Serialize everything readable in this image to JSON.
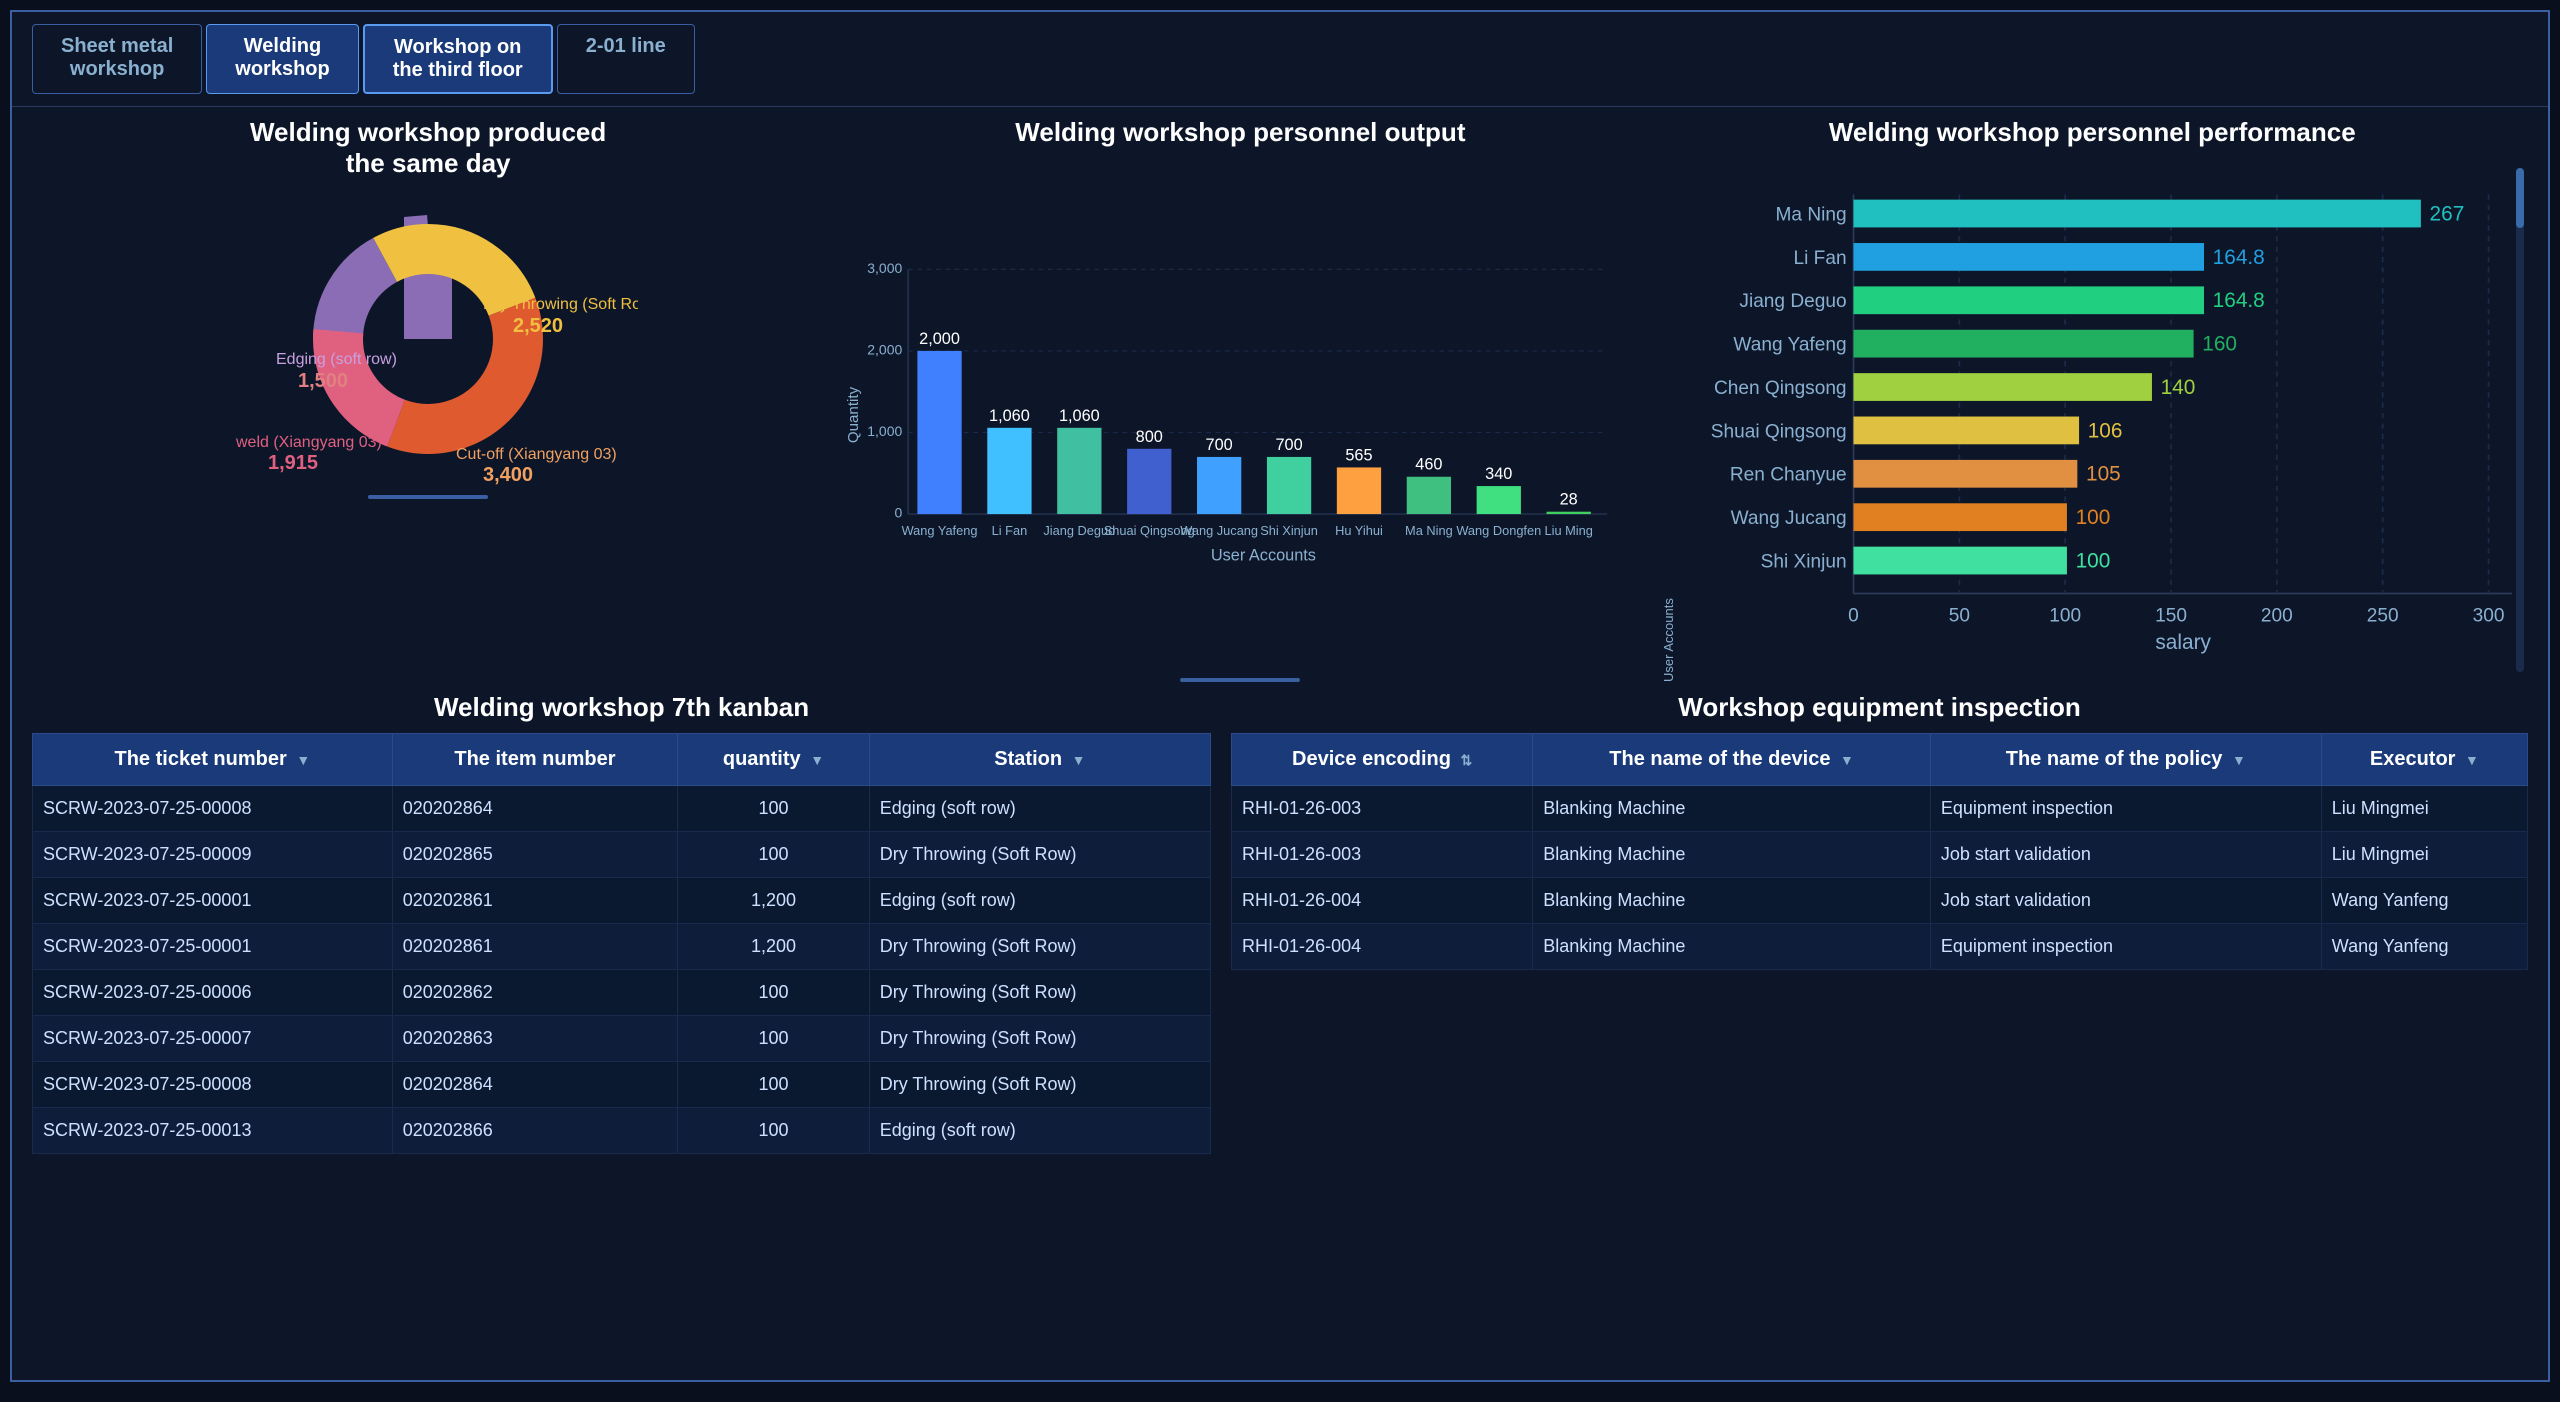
{
  "tabs": [
    {
      "label": "Sheet metal\nworkshop",
      "active": false
    },
    {
      "label": "Welding\nworkshop",
      "active": true
    },
    {
      "label": "Workshop on\nthe third floor",
      "active": true
    },
    {
      "label": "2-01 line",
      "active": false
    }
  ],
  "donut": {
    "title": "Welding workshop produced the same day",
    "segments": [
      {
        "label": "Edging (soft row)",
        "value": 1500,
        "color": "#8b6db5",
        "percentage": 17
      },
      {
        "label": "Dry Throwing (Soft Row)",
        "value": 2520,
        "color": "#f0c040",
        "percentage": 29
      },
      {
        "label": "Cut-off (Xiangyang 03)",
        "value": 3400,
        "color": "#e05a30",
        "percentage": 39
      },
      {
        "label": "weld (Xiangyang 03)",
        "value": 1915,
        "color": "#e06080",
        "percentage": 22
      }
    ]
  },
  "bar_chart": {
    "title": "Welding workshop personnel output",
    "y_label": "Quantity",
    "x_label": "User Accounts",
    "y_max": 3000,
    "y_ticks": [
      0,
      1000,
      2000,
      3000
    ],
    "bars": [
      {
        "name": "Wang Yafeng",
        "value": 2000,
        "color": "#4080ff"
      },
      {
        "name": "Li Fan",
        "value": 1060,
        "color": "#40c0ff"
      },
      {
        "name": "Jiang Deguo",
        "value": 1060,
        "color": "#40c0a0"
      },
      {
        "name": "Shuai Qingsong",
        "value": 800,
        "color": "#4060d0"
      },
      {
        "name": "Wang Jucang",
        "value": 700,
        "color": "#40a0ff"
      },
      {
        "name": "Shi Xinjun",
        "value": 700,
        "color": "#40d0a0"
      },
      {
        "name": "Hu Yihui",
        "value": 565,
        "color": "#ffa040"
      },
      {
        "name": "Ma Ning",
        "value": 460,
        "color": "#40c080"
      },
      {
        "name": "Wang Dongfen",
        "value": 340,
        "color": "#40e080"
      },
      {
        "name": "Liu Ming",
        "value": 28,
        "color": "#40d060"
      }
    ]
  },
  "h_bar_chart": {
    "title": "Welding workshop personnel performance",
    "x_label": "salary",
    "x_ticks": [
      0,
      50,
      100,
      150,
      200,
      250,
      300
    ],
    "bars": [
      {
        "name": "Ma Ning",
        "value": 267,
        "color": "#20c0c0"
      },
      {
        "name": "Li Fan",
        "value": 164.8,
        "color": "#20a0e0"
      },
      {
        "name": "Jiang Deguo",
        "value": 164.8,
        "color": "#20d080"
      },
      {
        "name": "Wang Yafeng",
        "value": 160,
        "color": "#20b060"
      },
      {
        "name": "Chen Qingsong",
        "value": 140,
        "color": "#a0d040"
      },
      {
        "name": "Shuai Qingsong",
        "value": 106,
        "color": "#e0c040"
      },
      {
        "name": "Ren Chanyue",
        "value": 105,
        "color": "#e09040"
      },
      {
        "name": "Wang Jucang",
        "value": 100,
        "color": "#e08020"
      },
      {
        "name": "Shi Xinjun",
        "value": 100,
        "color": "#40e0a0"
      }
    ],
    "x_max": 310
  },
  "kanban_table": {
    "title": "Welding workshop 7th kanban",
    "columns": [
      "The ticket number",
      "The item number",
      "quantity",
      "Station"
    ],
    "rows": [
      {
        "ticket": "SCRW-2023-07-25-00008",
        "item": "020202864",
        "quantity": "100",
        "station": "Edging (soft row)"
      },
      {
        "ticket": "SCRW-2023-07-25-00009",
        "item": "020202865",
        "quantity": "100",
        "station": "Dry Throwing (Soft Row)"
      },
      {
        "ticket": "SCRW-2023-07-25-00001",
        "item": "020202861",
        "quantity": "1,200",
        "station": "Edging (soft row)"
      },
      {
        "ticket": "SCRW-2023-07-25-00001",
        "item": "020202861",
        "quantity": "1,200",
        "station": "Dry Throwing (Soft Row)"
      },
      {
        "ticket": "SCRW-2023-07-25-00006",
        "item": "020202862",
        "quantity": "100",
        "station": "Dry Throwing (Soft Row)"
      },
      {
        "ticket": "SCRW-2023-07-25-00007",
        "item": "020202863",
        "quantity": "100",
        "station": "Dry Throwing (Soft Row)"
      },
      {
        "ticket": "SCRW-2023-07-25-00008",
        "item": "020202864",
        "quantity": "100",
        "station": "Dry Throwing (Soft Row)"
      },
      {
        "ticket": "SCRW-2023-07-25-00013",
        "item": "020202866",
        "quantity": "100",
        "station": "Edging (soft row)"
      }
    ]
  },
  "inspection_table": {
    "title": "Workshop equipment inspection",
    "columns": [
      "Device encoding",
      "The name of the device",
      "The name of the policy",
      "Executor"
    ],
    "rows": [
      {
        "device_enc": "RHI-01-26-003",
        "device_name": "Blanking Machine",
        "policy": "Equipment inspection",
        "executor": "Liu Mingmei"
      },
      {
        "device_enc": "RHI-01-26-003",
        "device_name": "Blanking Machine",
        "policy": "Job start validation",
        "executor": "Liu Mingmei"
      },
      {
        "device_enc": "RHI-01-26-004",
        "device_name": "Blanking Machine",
        "policy": "Job start validation",
        "executor": "Wang Yanfeng"
      },
      {
        "device_enc": "RHI-01-26-004",
        "device_name": "Blanking Machine",
        "policy": "Equipment inspection",
        "executor": "Wang Yanfeng"
      }
    ]
  }
}
